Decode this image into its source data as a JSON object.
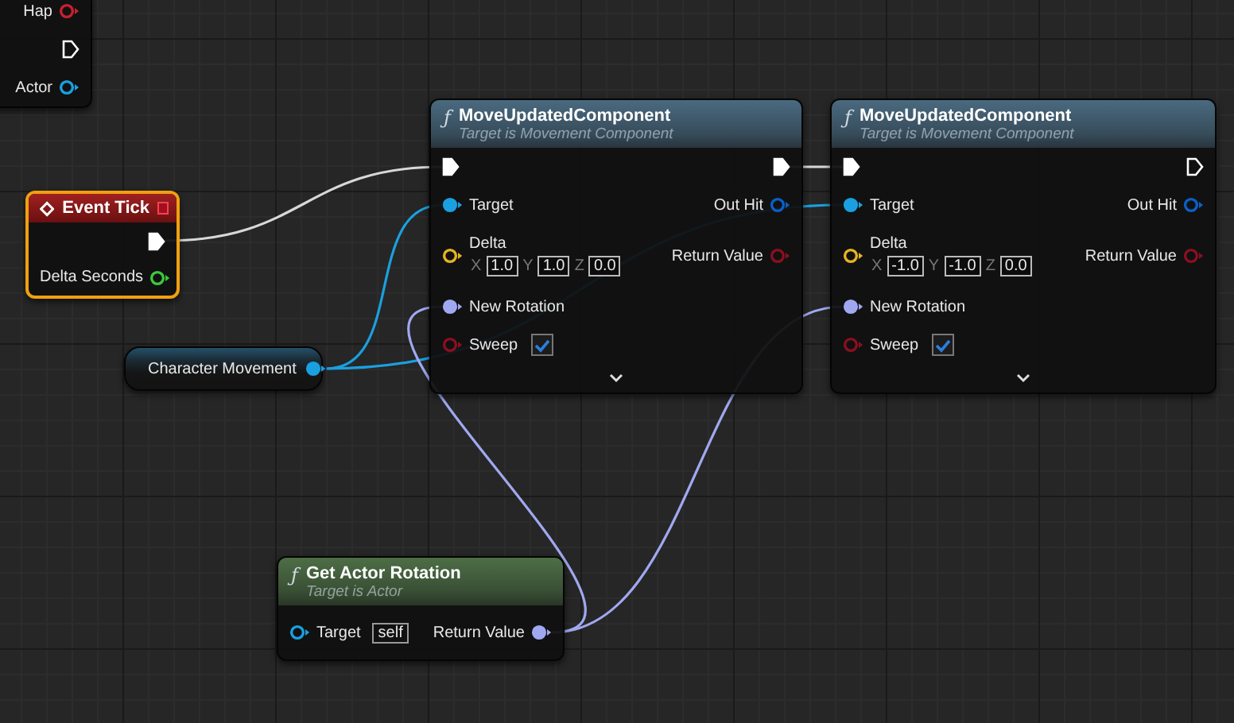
{
  "nodes": [
    {
      "kind": "plain",
      "selected": false,
      "rows": [
        {
          "right": {
            "kind": "data",
            "label": "Hap",
            "color": "#c8202e",
            "connected": false
          }
        },
        {
          "right": {
            "kind": "exec",
            "connected": false
          }
        },
        {
          "right": {
            "kind": "data",
            "label": "Actor",
            "color": "#1aa0e0",
            "connected": false
          }
        }
      ]
    },
    {
      "kind": "event",
      "title": "Event Tick",
      "selected": true,
      "rows": [
        {
          "right": {
            "kind": "exec",
            "connected": true
          }
        },
        {
          "right": {
            "kind": "data",
            "label": "Delta Seconds",
            "color": "#3cc83c",
            "connected": false
          }
        }
      ]
    },
    {
      "kind": "variable",
      "title": "Character Movement",
      "selected": false,
      "rows": [
        {
          "right": {
            "kind": "data",
            "color": "#1aa0e0",
            "connected": true
          }
        }
      ]
    },
    {
      "kind": "function",
      "icon_glyph": "ƒ",
      "title": "MoveUpdatedComponent",
      "subtitle": "Target is Movement Component",
      "color": "#4a6a80",
      "selected": false,
      "expandable": true,
      "rows": [
        {
          "left": {
            "kind": "exec",
            "connected": true
          },
          "right": {
            "kind": "exec",
            "connected": true
          }
        },
        {
          "left": {
            "kind": "data",
            "label": "Target",
            "color": "#1aa0e0",
            "connected": true
          },
          "right": {
            "kind": "data",
            "label": "Out Hit",
            "color": "#0a5fc8",
            "connected": false
          }
        },
        {
          "left": {
            "kind": "vector",
            "label": "Delta",
            "color": "#e6b422",
            "connected": false,
            "fields": [
              {
                "axis": "X",
                "value": "1.0"
              },
              {
                "axis": "Y",
                "value": "1.0"
              },
              {
                "axis": "Z",
                "value": "0.0"
              }
            ]
          },
          "right": {
            "kind": "data",
            "label": "Return Value",
            "color": "#8a1020",
            "connected": false
          }
        },
        {
          "left": {
            "kind": "data",
            "label": "New Rotation",
            "color": "#a0a8f0",
            "connected": true
          }
        },
        {
          "left": {
            "kind": "bool",
            "label": "Sweep",
            "color": "#8a1020",
            "connected": false,
            "checked": true
          }
        }
      ]
    },
    {
      "kind": "function",
      "icon_glyph": "ƒ",
      "title": "MoveUpdatedComponent",
      "subtitle": "Target is Movement Component",
      "color": "#4a6a80",
      "selected": false,
      "expandable": true,
      "rows": [
        {
          "left": {
            "kind": "exec",
            "connected": true
          },
          "right": {
            "kind": "exec",
            "connected": false
          }
        },
        {
          "left": {
            "kind": "data",
            "label": "Target",
            "color": "#1aa0e0",
            "connected": true
          },
          "right": {
            "kind": "data",
            "label": "Out Hit",
            "color": "#0a5fc8",
            "connected": false
          }
        },
        {
          "left": {
            "kind": "vector",
            "label": "Delta",
            "color": "#e6b422",
            "connected": false,
            "fields": [
              {
                "axis": "X",
                "value": "-1.0"
              },
              {
                "axis": "Y",
                "value": "-1.0"
              },
              {
                "axis": "Z",
                "value": "0.0"
              }
            ]
          },
          "right": {
            "kind": "data",
            "label": "Return Value",
            "color": "#8a1020",
            "connected": false
          }
        },
        {
          "left": {
            "kind": "data",
            "label": "New Rotation",
            "color": "#a0a8f0",
            "connected": true
          }
        },
        {
          "left": {
            "kind": "bool",
            "label": "Sweep",
            "color": "#8a1020",
            "connected": false,
            "checked": true
          }
        }
      ]
    },
    {
      "kind": "function",
      "icon_glyph": "ƒ",
      "title": "Get Actor Rotation",
      "subtitle": "Target is Actor",
      "color": "#4d6e46",
      "selected": false,
      "expandable": false,
      "rows": [
        {
          "left": {
            "kind": "data",
            "label": "Target",
            "color": "#1aa0e0",
            "connected": false,
            "default": "self"
          },
          "right": {
            "kind": "data",
            "label": "Return Value",
            "color": "#a0a8f0",
            "connected": true
          }
        }
      ]
    }
  ]
}
